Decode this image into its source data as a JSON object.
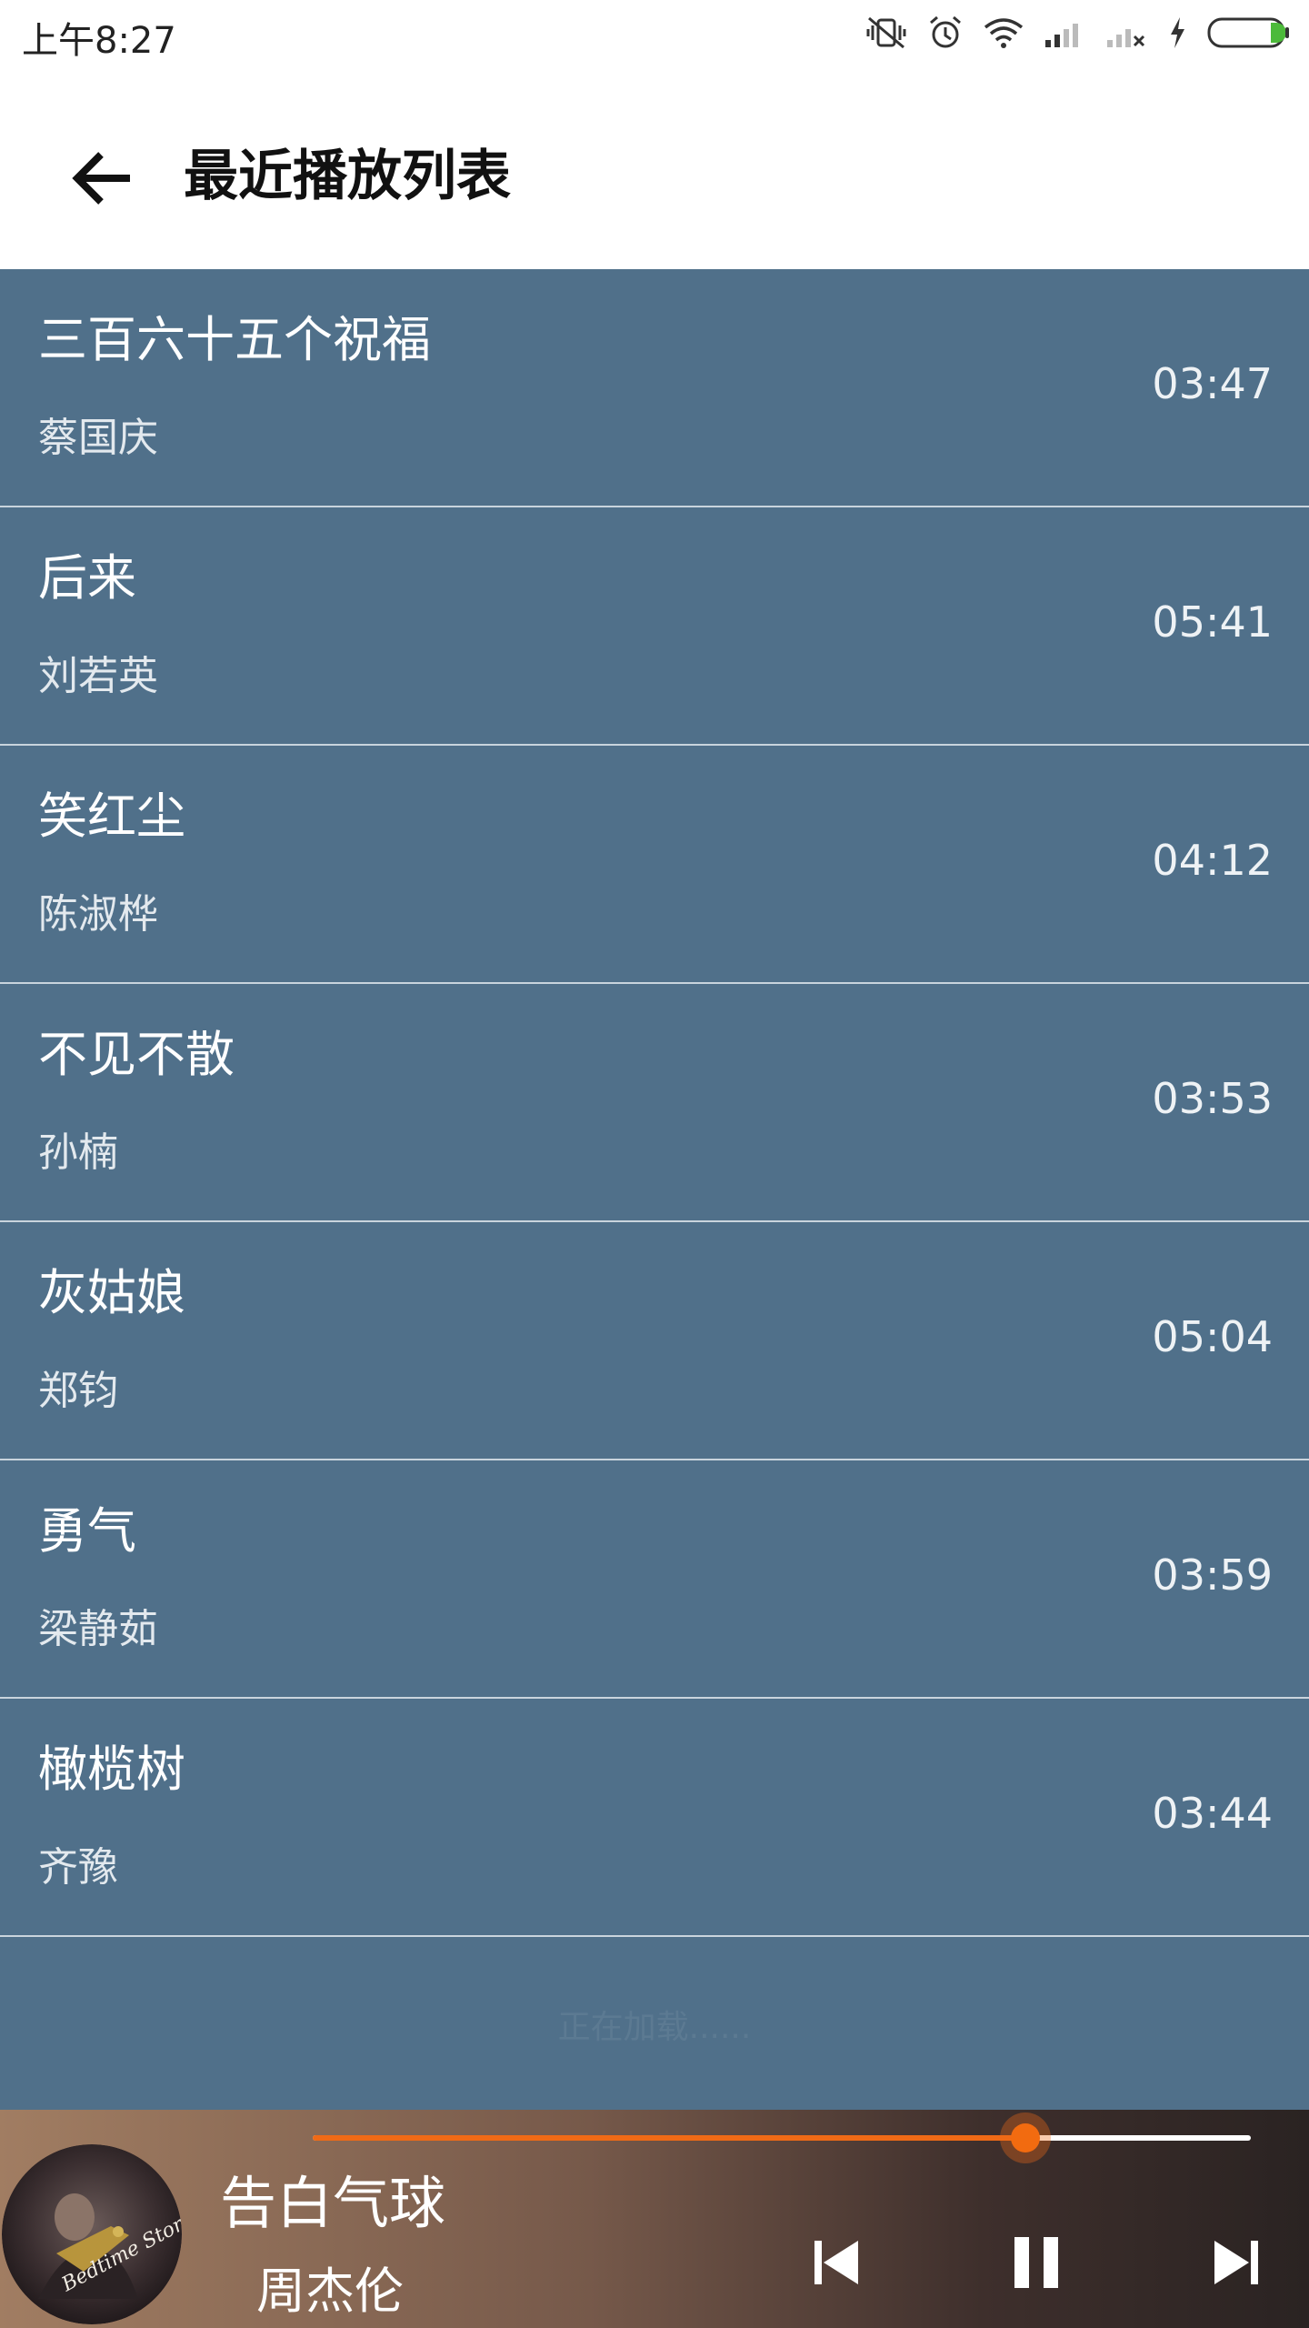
{
  "status_bar": {
    "time": "上午8:27",
    "icons": [
      "mute-vibrate-icon",
      "alarm-icon",
      "wifi-icon",
      "signal-icon",
      "signal-no-sim-icon",
      "charging-icon",
      "battery-icon"
    ]
  },
  "header": {
    "back_icon": "arrow-left-icon",
    "title": "最近播放列表"
  },
  "playlist": {
    "songs": [
      {
        "title": "三百六十五个祝福",
        "artist": "蔡国庆",
        "duration": "03:47"
      },
      {
        "title": "后来",
        "artist": "刘若英",
        "duration": "05:41"
      },
      {
        "title": "笑红尘",
        "artist": "陈淑桦",
        "duration": "04:12"
      },
      {
        "title": "不见不散",
        "artist": "孙楠",
        "duration": "03:53"
      },
      {
        "title": "灰姑娘",
        "artist": "郑钧",
        "duration": "05:04"
      },
      {
        "title": "勇气",
        "artist": "梁静茹",
        "duration": "03:59"
      },
      {
        "title": "橄榄树",
        "artist": "齐豫",
        "duration": "03:44"
      }
    ],
    "loading_text": "正在加载......"
  },
  "player": {
    "title": "告白气球",
    "artist": "周杰伦",
    "progress": 0.76,
    "album_art_text": "Bedtime Stories",
    "controls": {
      "prev_icon": "skip-previous-icon",
      "pause_icon": "pause-icon",
      "next_icon": "skip-next-icon"
    }
  },
  "colors": {
    "list_background": "#50708a",
    "accent": "#f06a16",
    "divider": "#c9d4dd"
  }
}
